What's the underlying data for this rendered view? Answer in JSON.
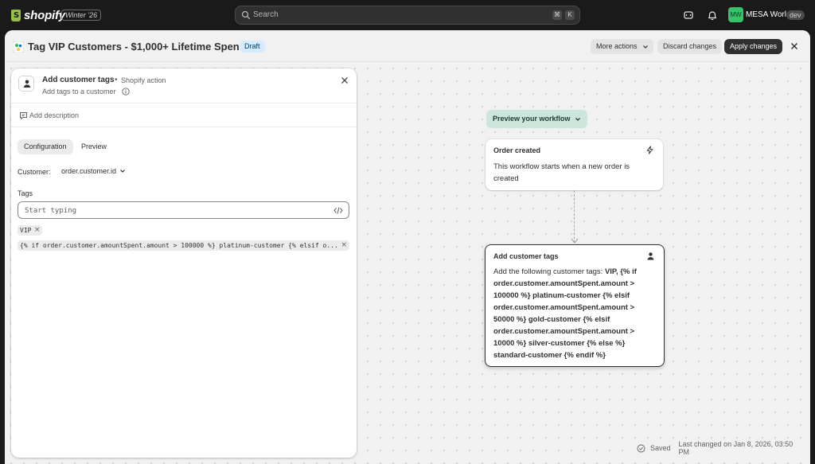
{
  "topbar": {
    "logo_text": "shopify",
    "edition": "Winter '26",
    "search_placeholder": "Search",
    "shortcut_keys": [
      "⌘",
      "K"
    ],
    "avatar_initials": "MW",
    "store_name": "MESA World",
    "store_badge": "dev"
  },
  "header": {
    "title": "Tag VIP Customers - $1,000+ Lifetime Spend",
    "status_badge": "Draft",
    "more_actions_label": "More actions",
    "discard_label": "Discard changes",
    "apply_label": "Apply changes"
  },
  "panel": {
    "step_title": "Add customer tags",
    "separator": "•",
    "step_source": "Shopify action",
    "step_subtitle": "Add tags to a customer",
    "add_description_label": "Add description",
    "tabs": [
      {
        "label": "Configuration",
        "active": true
      },
      {
        "label": "Preview",
        "active": false
      }
    ],
    "customer_label": "Customer:",
    "customer_value": "order.customer.id",
    "tags_label": "Tags",
    "tags_placeholder": "Start typing",
    "chips": [
      {
        "text": "VIP",
        "remove": "×"
      },
      {
        "text": "{% if order.customer.amountSpent.amount > 100000 %} platinum-customer {% elsif o...",
        "remove": "×"
      }
    ]
  },
  "workflow": {
    "preview_label": "Preview your workflow",
    "trigger": {
      "title": "Order created",
      "body": "This workflow starts when a new order is created"
    },
    "action": {
      "title": "Add customer tags",
      "body_prefix": "Add the following customer tags: ",
      "body_tags": "VIP, {% if order.customer.amountSpent.amount > 100000 %} platinum-customer {% elsif order.customer.amountSpent.amount > 50000 %} gold-customer {% elsif order.customer.amountSpent.amount > 10000 %} silver-customer {% else %} standard-customer {% endif %}"
    }
  },
  "status": {
    "saved_label": "Saved",
    "last_changed": "Last changed on Jan 8, 2026, 03:50 PM"
  },
  "colors": {
    "topbar_bg": "#1a1a1a",
    "logo_green": "#95bf47",
    "avatar_green": "#36c46b",
    "draft_badge_bg": "#d5ebff",
    "preview_btn_bg": "#cde6dc",
    "primary_btn": "#303030"
  },
  "icons": {
    "search": "search-icon",
    "cart": "cart-icon",
    "bell": "bell-icon",
    "person": "person-icon",
    "bolt": "bolt-icon",
    "code": "code-icon",
    "info": "info-icon",
    "comment": "comment-icon",
    "check": "check-circle-icon"
  }
}
